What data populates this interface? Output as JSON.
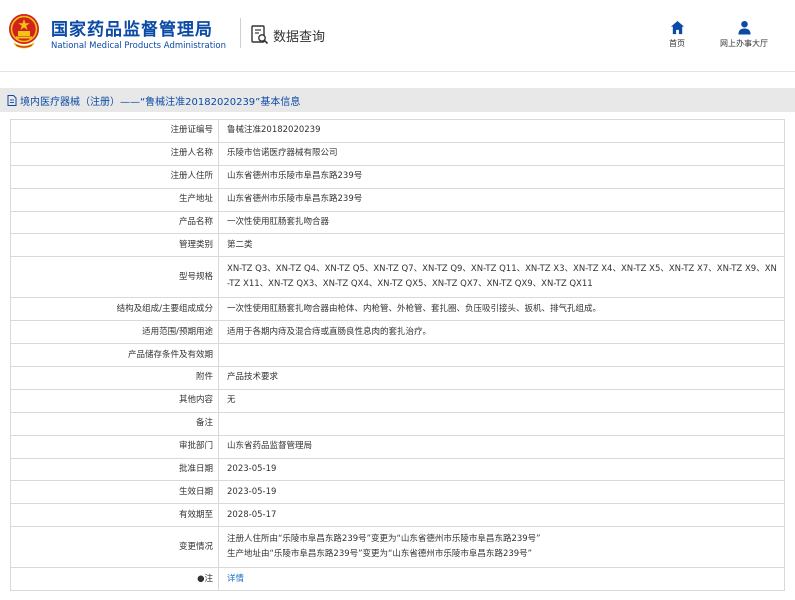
{
  "header": {
    "brand_cn": "国家药品监督管理局",
    "brand_en": "National Medical Products Administration",
    "query_label": "数据查询",
    "nav": {
      "home_label": "首页",
      "hall_label": "网上办事大厅"
    }
  },
  "page": {
    "title": "境内医疗器械（注册）——“鲁械注准20182020239”基本信息"
  },
  "colors": {
    "brand_blue": "#0b4aa5",
    "emblem_red": "#d0231b",
    "emblem_gold": "#f3c316",
    "link_blue": "#1f6fd0"
  },
  "rows": [
    {
      "label": "注册证编号",
      "value": "鲁械注准20182020239"
    },
    {
      "label": "注册人名称",
      "value": "乐陵市信诺医疗器械有限公司"
    },
    {
      "label": "注册人住所",
      "value": "山东省德州市乐陵市阜昌东路239号"
    },
    {
      "label": "生产地址",
      "value": "山东省德州市乐陵市阜昌东路239号"
    },
    {
      "label": "产品名称",
      "value": "一次性使用肛肠套扎吻合器"
    },
    {
      "label": "管理类别",
      "value": "第二类"
    },
    {
      "label": "型号规格",
      "value": "XN-TZ Q3、XN-TZ Q4、XN-TZ Q5、XN-TZ Q7、XN-TZ Q9、XN-TZ Q11、XN-TZ X3、XN-TZ X4、XN-TZ X5、XN-TZ X7、XN-TZ X9、XN-TZ X11、XN-TZ QX3、XN-TZ QX4、XN-TZ QX5、XN-TZ QX7、XN-TZ QX9、XN-TZ QX11"
    },
    {
      "label": "结构及组成/主要组成成分",
      "value": "一次性使用肛肠套扎吻合器由枪体、内枪管、外枪管、套扎圈、负压吸引接头、扳机、排气孔组成。"
    },
    {
      "label": "适用范围/预期用途",
      "value": "适用于各期内痔及混合痔或直肠良性息肉的套扎治疗。"
    },
    {
      "label": "产品储存条件及有效期",
      "value": ""
    },
    {
      "label": "附件",
      "value": "产品技术要求"
    },
    {
      "label": "其他内容",
      "value": "无"
    },
    {
      "label": "备注",
      "value": ""
    },
    {
      "label": "审批部门",
      "value": "山东省药品监督管理局"
    },
    {
      "label": "批准日期",
      "value": "2023-05-19"
    },
    {
      "label": "生效日期",
      "value": "2023-05-19"
    },
    {
      "label": "有效期至",
      "value": "2028-05-17"
    }
  ],
  "change": {
    "label": "变更情况",
    "lines": [
      "注册人住所由“乐陵市阜昌东路239号”变更为“山东省德州市乐陵市阜昌东路239号”",
      "生产地址由“乐陵市阜昌东路239号”变更为“山东省德州市乐陵市阜昌东路239号”"
    ]
  },
  "note_row": {
    "label": "注",
    "link_text": "详情"
  }
}
